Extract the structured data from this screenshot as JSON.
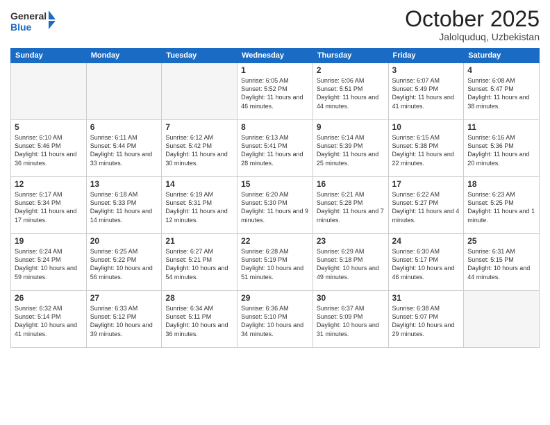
{
  "logo": {
    "general": "General",
    "blue": "Blue"
  },
  "title": "October 2025",
  "location": "Jalolquduq, Uzbekistan",
  "weekdays": [
    "Sunday",
    "Monday",
    "Tuesday",
    "Wednesday",
    "Thursday",
    "Friday",
    "Saturday"
  ],
  "weeks": [
    [
      {
        "num": "",
        "info": ""
      },
      {
        "num": "",
        "info": ""
      },
      {
        "num": "",
        "info": ""
      },
      {
        "num": "1",
        "info": "Sunrise: 6:05 AM\nSunset: 5:52 PM\nDaylight: 11 hours and 46 minutes."
      },
      {
        "num": "2",
        "info": "Sunrise: 6:06 AM\nSunset: 5:51 PM\nDaylight: 11 hours and 44 minutes."
      },
      {
        "num": "3",
        "info": "Sunrise: 6:07 AM\nSunset: 5:49 PM\nDaylight: 11 hours and 41 minutes."
      },
      {
        "num": "4",
        "info": "Sunrise: 6:08 AM\nSunset: 5:47 PM\nDaylight: 11 hours and 38 minutes."
      }
    ],
    [
      {
        "num": "5",
        "info": "Sunrise: 6:10 AM\nSunset: 5:46 PM\nDaylight: 11 hours and 36 minutes."
      },
      {
        "num": "6",
        "info": "Sunrise: 6:11 AM\nSunset: 5:44 PM\nDaylight: 11 hours and 33 minutes."
      },
      {
        "num": "7",
        "info": "Sunrise: 6:12 AM\nSunset: 5:42 PM\nDaylight: 11 hours and 30 minutes."
      },
      {
        "num": "8",
        "info": "Sunrise: 6:13 AM\nSunset: 5:41 PM\nDaylight: 11 hours and 28 minutes."
      },
      {
        "num": "9",
        "info": "Sunrise: 6:14 AM\nSunset: 5:39 PM\nDaylight: 11 hours and 25 minutes."
      },
      {
        "num": "10",
        "info": "Sunrise: 6:15 AM\nSunset: 5:38 PM\nDaylight: 11 hours and 22 minutes."
      },
      {
        "num": "11",
        "info": "Sunrise: 6:16 AM\nSunset: 5:36 PM\nDaylight: 11 hours and 20 minutes."
      }
    ],
    [
      {
        "num": "12",
        "info": "Sunrise: 6:17 AM\nSunset: 5:34 PM\nDaylight: 11 hours and 17 minutes."
      },
      {
        "num": "13",
        "info": "Sunrise: 6:18 AM\nSunset: 5:33 PM\nDaylight: 11 hours and 14 minutes."
      },
      {
        "num": "14",
        "info": "Sunrise: 6:19 AM\nSunset: 5:31 PM\nDaylight: 11 hours and 12 minutes."
      },
      {
        "num": "15",
        "info": "Sunrise: 6:20 AM\nSunset: 5:30 PM\nDaylight: 11 hours and 9 minutes."
      },
      {
        "num": "16",
        "info": "Sunrise: 6:21 AM\nSunset: 5:28 PM\nDaylight: 11 hours and 7 minutes."
      },
      {
        "num": "17",
        "info": "Sunrise: 6:22 AM\nSunset: 5:27 PM\nDaylight: 11 hours and 4 minutes."
      },
      {
        "num": "18",
        "info": "Sunrise: 6:23 AM\nSunset: 5:25 PM\nDaylight: 11 hours and 1 minute."
      }
    ],
    [
      {
        "num": "19",
        "info": "Sunrise: 6:24 AM\nSunset: 5:24 PM\nDaylight: 10 hours and 59 minutes."
      },
      {
        "num": "20",
        "info": "Sunrise: 6:25 AM\nSunset: 5:22 PM\nDaylight: 10 hours and 56 minutes."
      },
      {
        "num": "21",
        "info": "Sunrise: 6:27 AM\nSunset: 5:21 PM\nDaylight: 10 hours and 54 minutes."
      },
      {
        "num": "22",
        "info": "Sunrise: 6:28 AM\nSunset: 5:19 PM\nDaylight: 10 hours and 51 minutes."
      },
      {
        "num": "23",
        "info": "Sunrise: 6:29 AM\nSunset: 5:18 PM\nDaylight: 10 hours and 49 minutes."
      },
      {
        "num": "24",
        "info": "Sunrise: 6:30 AM\nSunset: 5:17 PM\nDaylight: 10 hours and 46 minutes."
      },
      {
        "num": "25",
        "info": "Sunrise: 6:31 AM\nSunset: 5:15 PM\nDaylight: 10 hours and 44 minutes."
      }
    ],
    [
      {
        "num": "26",
        "info": "Sunrise: 6:32 AM\nSunset: 5:14 PM\nDaylight: 10 hours and 41 minutes."
      },
      {
        "num": "27",
        "info": "Sunrise: 6:33 AM\nSunset: 5:12 PM\nDaylight: 10 hours and 39 minutes."
      },
      {
        "num": "28",
        "info": "Sunrise: 6:34 AM\nSunset: 5:11 PM\nDaylight: 10 hours and 36 minutes."
      },
      {
        "num": "29",
        "info": "Sunrise: 6:36 AM\nSunset: 5:10 PM\nDaylight: 10 hours and 34 minutes."
      },
      {
        "num": "30",
        "info": "Sunrise: 6:37 AM\nSunset: 5:09 PM\nDaylight: 10 hours and 31 minutes."
      },
      {
        "num": "31",
        "info": "Sunrise: 6:38 AM\nSunset: 5:07 PM\nDaylight: 10 hours and 29 minutes."
      },
      {
        "num": "",
        "info": ""
      }
    ]
  ]
}
